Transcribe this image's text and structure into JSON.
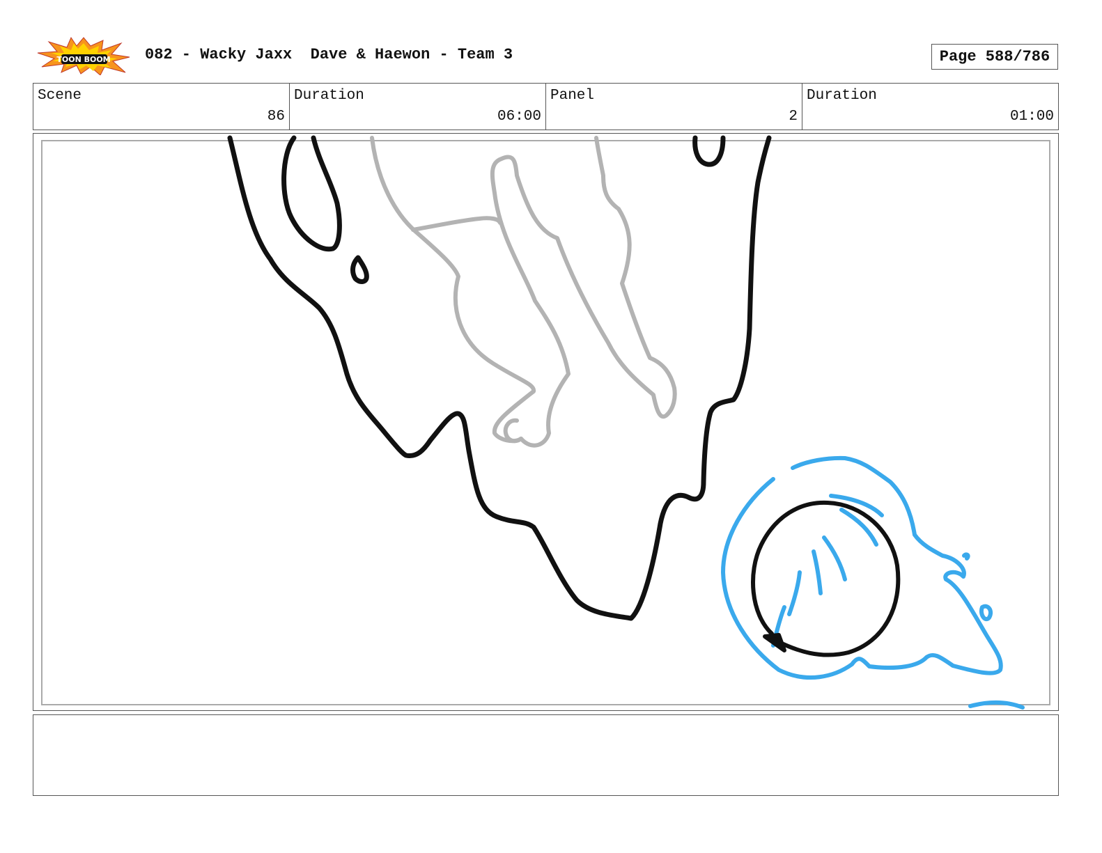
{
  "header": {
    "logo_text": "TOON BOOM",
    "title": "082 - Wacky Jaxx  Dave & Haewon - Team 3",
    "page_label": "Page 588/786"
  },
  "info": [
    {
      "label": "Scene",
      "value": "86"
    },
    {
      "label": "Duration",
      "value": "06:00"
    },
    {
      "label": "Panel",
      "value": "2"
    },
    {
      "label": "Duration",
      "value": "01:00"
    }
  ],
  "colors": {
    "ink": "#111111",
    "rough": "#b3b3b3",
    "blue_sketch": "#3aa9ec",
    "logo_orange": "#f7941d",
    "logo_yellow": "#ffd200"
  },
  "notes": {
    "text": ""
  }
}
